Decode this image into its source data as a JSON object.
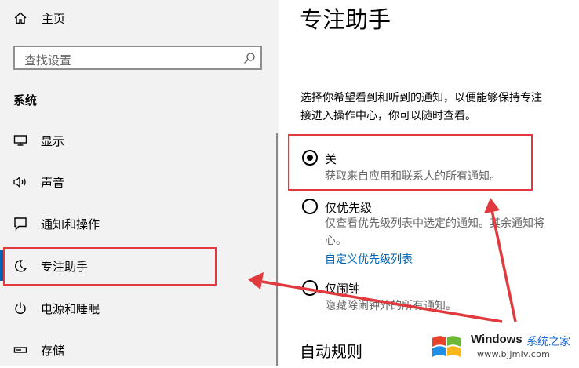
{
  "sidebar": {
    "home": {
      "label": "主页",
      "icon": "home-icon"
    },
    "search": {
      "placeholder": "查找设置",
      "icon": "search-icon"
    },
    "section_title": "系统",
    "items": [
      {
        "label": "显示",
        "icon": "monitor-icon"
      },
      {
        "label": "声音",
        "icon": "speaker-icon"
      },
      {
        "label": "通知和操作",
        "icon": "notification-icon"
      },
      {
        "label": "专注助手",
        "icon": "moon-icon",
        "active": true
      },
      {
        "label": "电源和睡眠",
        "icon": "power-icon"
      },
      {
        "label": "存储",
        "icon": "storage-icon"
      }
    ]
  },
  "main": {
    "title": "专注助手",
    "description": {
      "line1": "选择你希望看到和听到的通知，以便能够保持专注",
      "line2": "接进入操作中心，你可以随时查看。"
    },
    "options": [
      {
        "label": "关",
        "desc": "获取来自应用和联系人的所有通知。",
        "selected": true
      },
      {
        "label": "仅优先级",
        "desc_line1": "仅查看优先级列表中选定的通知。其余通知将",
        "desc_line2": "心。",
        "link": "自定义优先级列表",
        "selected": false
      },
      {
        "label": "仅闹钟",
        "desc": "隐藏除闹钟外的所有通知。",
        "selected": false
      }
    ],
    "sub_heading": "自动规则"
  },
  "annotations": {
    "highlight_color": "#e0393e"
  },
  "watermark": {
    "brand": "Windows",
    "site": "系统之家",
    "url": "www.bjjmlv.com"
  },
  "colors": {
    "accent": "#0063b1",
    "sidebar_bg": "#f2f2f2"
  }
}
